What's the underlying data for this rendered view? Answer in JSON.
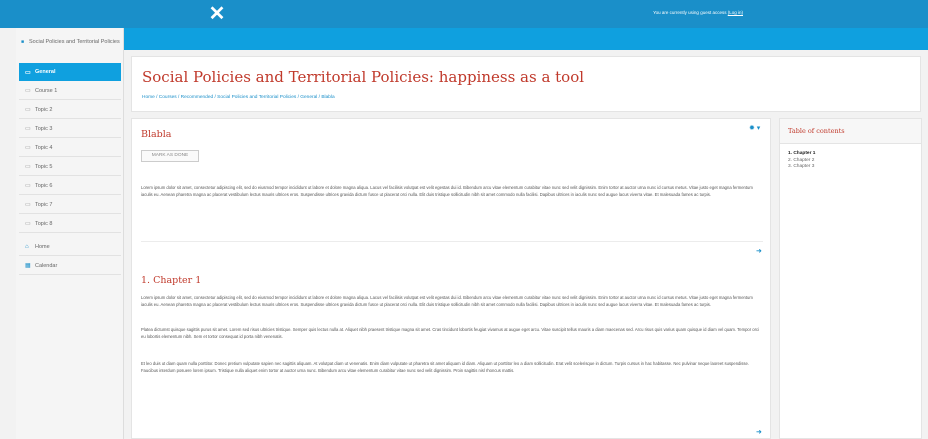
{
  "topbar": {
    "logo_glyph": "✕",
    "guest_text": "You are currently using guest access",
    "login_link": "(Log in)",
    "color": "#1a8fc9"
  },
  "sidebar": {
    "course_name": "Social Policies and Territorial Policies",
    "items": [
      {
        "label": "General",
        "icon": "folder-icon",
        "active": true
      },
      {
        "label": "Course 1",
        "icon": "folder-icon"
      },
      {
        "label": "Topic 2",
        "icon": "folder-icon"
      },
      {
        "label": "Topic 3",
        "icon": "folder-icon"
      },
      {
        "label": "Topic 4",
        "icon": "folder-icon"
      },
      {
        "label": "Topic 5",
        "icon": "folder-icon"
      },
      {
        "label": "Topic 6",
        "icon": "folder-icon"
      },
      {
        "label": "Topic 7",
        "icon": "folder-icon"
      },
      {
        "label": "Topic 8",
        "icon": "folder-icon"
      },
      {
        "label": "Home",
        "icon": "home-icon"
      },
      {
        "label": "Calendar",
        "icon": "calendar-icon"
      }
    ]
  },
  "header": {
    "title": "Social Policies and Territorial Policies: happiness as a tool",
    "breadcrumb": "Home / Courses / Recommended / Social Policies and Territorial Policies / General / Blabla"
  },
  "main": {
    "section_title": "Blabla",
    "mark_done_label": "MARK AS DONE",
    "intro_text": "Lorem ipsum dolor sit amet, consectetur adipiscing elit, sed do eiusmod tempor incididunt ut labore et dolore magna aliqua. Lacus vel facilisis volutpat est velit egestas dui id. Bibendum arcu vitae elementum curabitur vitae nunc sed velit dignissim. Enim tortor at auctor urna nunc id cursus metus. Vitae justo eget magna fermentum iaculis eu. Aenean pharetra magna ac placerat vestibulum lectus mauris ultrices eros. Suspendisse ultrices gravida dictum fusce ut placerat orci nulla. Elit duis tristique sollicitudin nibh sit amet commodo nulla facilisi. Dapibus ultrices in iaculis nunc sed augue lacus viverra vitae. Et malesuada fames ac turpis.",
    "chapter_title": "1. Chapter 1",
    "chapter_p1": "Lorem ipsum dolor sit amet, consectetur adipiscing elit, sed do eiusmod tempor incididunt ut labore et dolore magna aliqua. Lacus vel facilisis volutpat est velit egestas dui id. Bibendum arcu vitae elementum curabitur vitae nunc sed velit dignissim. Enim tortor at auctor urna nunc id cursus metus. Vitae justo eget magna fermentum iaculis eu. Aenean pharetra magna ac placerat vestibulum lectus mauris ultrices eros. Suspendisse ultrices gravida dictum fusce ut placerat orci nulla. Elit duis tristique sollicitudin nibh sit amet commodo nulla facilisi. Dapibus ultrices in iaculis nunc sed augue lacus viverra vitae. Et malesuada fames ac turpis.",
    "chapter_p2": "Platea dictumst quisque sagittis purus sit amet. Lorem sed risus ultricies tristique. Semper quis lectus nulla at. Aliquet nibh praesent tristique magna sit amet. Cras tincidunt lobortis feugiat vivamus at augue eget arcu. Vitae suscipit tellus mauris a diam maecenas sed. Arcu risus quis varius quam quisque id diam vel quam. Tempor orci eu lobortis elementum nibh. Sem et tortor consequat id porta nibh venenatis.",
    "chapter_p3": "Et leo duis ut diam quam nulla porttitor. Donec pretium vulputate sapien nec sagittis aliquam. At volutpat diam ut venenatis. Enim diam vulputate ut pharetra sit amet aliquam id diam. Aliquam ut porttitor leo a diam sollicitudin. Erat velit scelerisque in dictum. Turpis cursus in hac habitasse. Nec pulvinar neque laoreet suspendisse. Faucibus interdum posuere lorem ipsum. Tristique nulla aliquet enim tortor at auctor urna nunc. Bibendum arcu vitae elementum curabitur vitae nunc sed velit dignissim. Proin sagittis nisl rhoncus mattis."
  },
  "toc": {
    "title": "Table of contents",
    "items": [
      {
        "label": "1. Chapter 1",
        "active": true
      },
      {
        "label": "2. Chapter 2"
      },
      {
        "label": "3. Chapter 3"
      }
    ]
  }
}
